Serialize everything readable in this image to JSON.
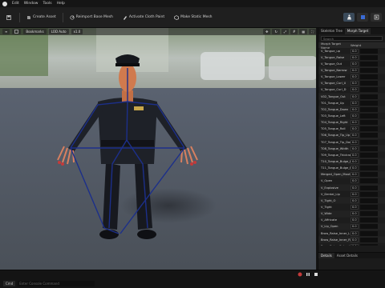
{
  "menu": {
    "items": [
      "Edit",
      "Window",
      "Tools",
      "Help"
    ]
  },
  "toolbar": {
    "buttons": [
      "Create Asset",
      "Reimport Base Mesh",
      "Activate Cloth Paint",
      "Make Static Mesh"
    ]
  },
  "viewport": {
    "toolbar_chips": [
      "Bookmarks",
      "LOD Auto",
      "x1.0"
    ]
  },
  "panel": {
    "tabs": [
      "Skeleton Tree",
      "Morph Target"
    ],
    "search_placeholder": "Search",
    "columns": [
      "Morph Target Name",
      "Weight"
    ],
    "rows": [
      {
        "name": "V_Tongue_up",
        "weight": "0.0"
      },
      {
        "name": "V_Tongue_Raise",
        "weight": "0.0"
      },
      {
        "name": "V_Tongue_Out",
        "weight": "0.0"
      },
      {
        "name": "V_Tongue_Narrow",
        "weight": "0.0"
      },
      {
        "name": "V_Tongue_Lower",
        "weight": "0.0"
      },
      {
        "name": "V_Tongue_Curl_U",
        "weight": "0.0"
      },
      {
        "name": "V_Tongue_Curl_D",
        "weight": "0.0"
      },
      {
        "name": "V02_Tongue_Out",
        "weight": "0.0"
      },
      {
        "name": "T01_Tongue_Up",
        "weight": "0.0"
      },
      {
        "name": "T02_Tongue_Down",
        "weight": "0.0"
      },
      {
        "name": "T03_Tongue_Left",
        "weight": "0.0"
      },
      {
        "name": "T04_Tongue_Right",
        "weight": "0.0"
      },
      {
        "name": "T05_Tongue_Roll",
        "weight": "0.0"
      },
      {
        "name": "T06_Tongue_Tip_Up",
        "weight": "0.0"
      },
      {
        "name": "T07_Tongue_Tip_Down",
        "weight": "0.0"
      },
      {
        "name": "T08_Tongue_Width",
        "weight": "0.0"
      },
      {
        "name": "T09_Tongue_Thickness",
        "weight": "0.0"
      },
      {
        "name": "T10_Tongue_Bulge_Left",
        "weight": "0.0"
      },
      {
        "name": "T11_Tongue_Bulge_Right",
        "weight": "0.0"
      },
      {
        "name": "Merged_Open_Mouth",
        "weight": "0.0"
      },
      {
        "name": "V_Open",
        "weight": "0.0"
      },
      {
        "name": "V_Explosive",
        "weight": "0.0"
      },
      {
        "name": "V_Dental_Lip",
        "weight": "0.0"
      },
      {
        "name": "V_Tight_O",
        "weight": "0.0"
      },
      {
        "name": "V_Tight",
        "weight": "0.0"
      },
      {
        "name": "V_Wide",
        "weight": "0.0"
      },
      {
        "name": "V_Affricate",
        "weight": "0.0"
      },
      {
        "name": "V_Lip_Open",
        "weight": "0.0"
      },
      {
        "name": "Brow_Raise_Inner_L",
        "weight": "0.0"
      },
      {
        "name": "Brow_Raise_Inner_R",
        "weight": "0.0"
      },
      {
        "name": "Brow_Raise_Outer_L",
        "weight": "0.0"
      }
    ],
    "details_tabs": [
      "Details",
      "Asset Details"
    ]
  },
  "statusbar": {
    "cmd_label": "Cmd",
    "cmd_placeholder": "Enter Console Command"
  },
  "colors": {
    "accent_red": "#c43a3a",
    "bone_blue": "#1c2f8a"
  }
}
